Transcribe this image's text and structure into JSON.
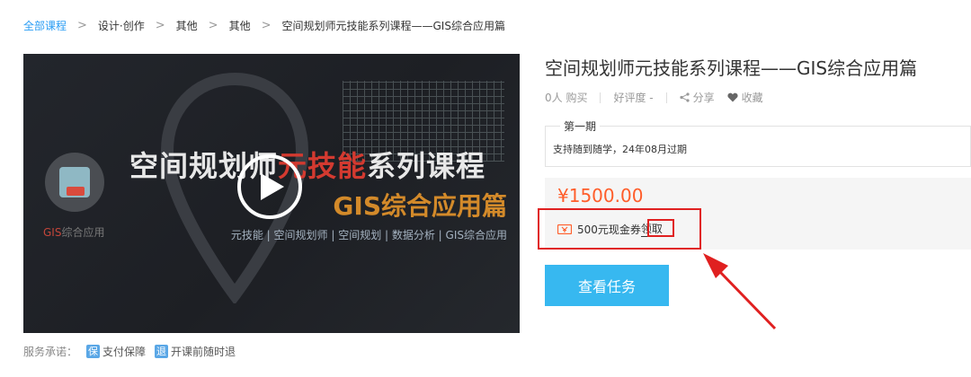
{
  "breadcrumb": {
    "items": [
      "全部课程",
      "设计·创作",
      "其他",
      "其他",
      "空间规划师元技能系列课程——GIS综合应用篇"
    ],
    "separator": ">"
  },
  "media": {
    "logo_text_gis": "GIS",
    "logo_text_rest": "综合应用",
    "title_part1": "空间规划师",
    "title_accent": "元技能",
    "title_part2": "系列课程",
    "subtitle": "GIS综合应用篇",
    "tagline": "元技能 | 空间规划师 | 空间规划 | 数据分析 | GIS综合应用",
    "play_icon": "play-icon"
  },
  "service_promise": {
    "label": "服务承诺：",
    "badges": [
      {
        "icon_char": "保",
        "text": "支付保障"
      },
      {
        "icon_char": "退",
        "text": "开课前随时退"
      }
    ]
  },
  "course": {
    "title": "空间规划师元技能系列课程——GIS综合应用篇",
    "buyers": "0人 购买",
    "rating": "好评度 -",
    "share": "分享",
    "favorite": "收藏"
  },
  "period": {
    "legend": "第一期",
    "description": "支持随到随学，24年08月过期"
  },
  "pricing": {
    "price": "¥1500.00",
    "coupon_text": "500元现金券",
    "claim": "领取"
  },
  "cta": {
    "label": "查看任务"
  },
  "colors": {
    "link": "#2a9df4",
    "price": "#ff5d2a",
    "cta": "#37b8f0",
    "annotation": "#e02020"
  }
}
